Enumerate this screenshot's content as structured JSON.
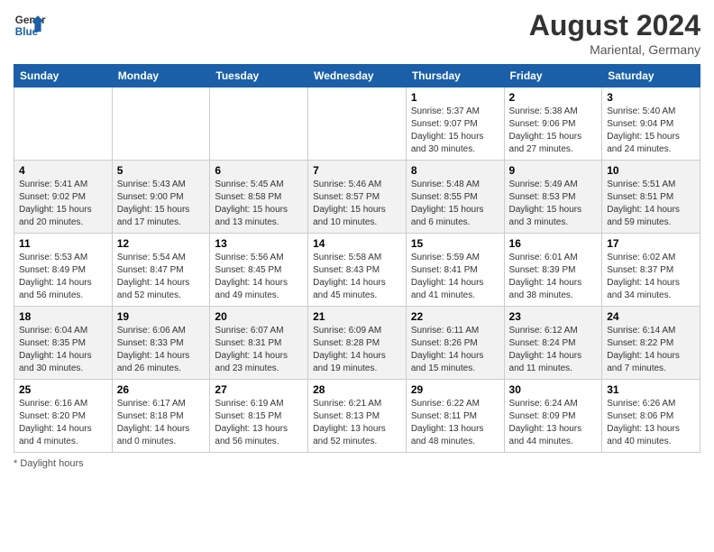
{
  "header": {
    "logo_general": "General",
    "logo_blue": "Blue",
    "month_year": "August 2024",
    "location": "Mariental, Germany"
  },
  "days_of_week": [
    "Sunday",
    "Monday",
    "Tuesday",
    "Wednesday",
    "Thursday",
    "Friday",
    "Saturday"
  ],
  "weeks": [
    [
      {
        "day": "",
        "info": ""
      },
      {
        "day": "",
        "info": ""
      },
      {
        "day": "",
        "info": ""
      },
      {
        "day": "",
        "info": ""
      },
      {
        "day": "1",
        "info": "Sunrise: 5:37 AM\nSunset: 9:07 PM\nDaylight: 15 hours\nand 30 minutes."
      },
      {
        "day": "2",
        "info": "Sunrise: 5:38 AM\nSunset: 9:06 PM\nDaylight: 15 hours\nand 27 minutes."
      },
      {
        "day": "3",
        "info": "Sunrise: 5:40 AM\nSunset: 9:04 PM\nDaylight: 15 hours\nand 24 minutes."
      }
    ],
    [
      {
        "day": "4",
        "info": "Sunrise: 5:41 AM\nSunset: 9:02 PM\nDaylight: 15 hours\nand 20 minutes."
      },
      {
        "day": "5",
        "info": "Sunrise: 5:43 AM\nSunset: 9:00 PM\nDaylight: 15 hours\nand 17 minutes."
      },
      {
        "day": "6",
        "info": "Sunrise: 5:45 AM\nSunset: 8:58 PM\nDaylight: 15 hours\nand 13 minutes."
      },
      {
        "day": "7",
        "info": "Sunrise: 5:46 AM\nSunset: 8:57 PM\nDaylight: 15 hours\nand 10 minutes."
      },
      {
        "day": "8",
        "info": "Sunrise: 5:48 AM\nSunset: 8:55 PM\nDaylight: 15 hours\nand 6 minutes."
      },
      {
        "day": "9",
        "info": "Sunrise: 5:49 AM\nSunset: 8:53 PM\nDaylight: 15 hours\nand 3 minutes."
      },
      {
        "day": "10",
        "info": "Sunrise: 5:51 AM\nSunset: 8:51 PM\nDaylight: 14 hours\nand 59 minutes."
      }
    ],
    [
      {
        "day": "11",
        "info": "Sunrise: 5:53 AM\nSunset: 8:49 PM\nDaylight: 14 hours\nand 56 minutes."
      },
      {
        "day": "12",
        "info": "Sunrise: 5:54 AM\nSunset: 8:47 PM\nDaylight: 14 hours\nand 52 minutes."
      },
      {
        "day": "13",
        "info": "Sunrise: 5:56 AM\nSunset: 8:45 PM\nDaylight: 14 hours\nand 49 minutes."
      },
      {
        "day": "14",
        "info": "Sunrise: 5:58 AM\nSunset: 8:43 PM\nDaylight: 14 hours\nand 45 minutes."
      },
      {
        "day": "15",
        "info": "Sunrise: 5:59 AM\nSunset: 8:41 PM\nDaylight: 14 hours\nand 41 minutes."
      },
      {
        "day": "16",
        "info": "Sunrise: 6:01 AM\nSunset: 8:39 PM\nDaylight: 14 hours\nand 38 minutes."
      },
      {
        "day": "17",
        "info": "Sunrise: 6:02 AM\nSunset: 8:37 PM\nDaylight: 14 hours\nand 34 minutes."
      }
    ],
    [
      {
        "day": "18",
        "info": "Sunrise: 6:04 AM\nSunset: 8:35 PM\nDaylight: 14 hours\nand 30 minutes."
      },
      {
        "day": "19",
        "info": "Sunrise: 6:06 AM\nSunset: 8:33 PM\nDaylight: 14 hours\nand 26 minutes."
      },
      {
        "day": "20",
        "info": "Sunrise: 6:07 AM\nSunset: 8:31 PM\nDaylight: 14 hours\nand 23 minutes."
      },
      {
        "day": "21",
        "info": "Sunrise: 6:09 AM\nSunset: 8:28 PM\nDaylight: 14 hours\nand 19 minutes."
      },
      {
        "day": "22",
        "info": "Sunrise: 6:11 AM\nSunset: 8:26 PM\nDaylight: 14 hours\nand 15 minutes."
      },
      {
        "day": "23",
        "info": "Sunrise: 6:12 AM\nSunset: 8:24 PM\nDaylight: 14 hours\nand 11 minutes."
      },
      {
        "day": "24",
        "info": "Sunrise: 6:14 AM\nSunset: 8:22 PM\nDaylight: 14 hours\nand 7 minutes."
      }
    ],
    [
      {
        "day": "25",
        "info": "Sunrise: 6:16 AM\nSunset: 8:20 PM\nDaylight: 14 hours\nand 4 minutes."
      },
      {
        "day": "26",
        "info": "Sunrise: 6:17 AM\nSunset: 8:18 PM\nDaylight: 14 hours\nand 0 minutes."
      },
      {
        "day": "27",
        "info": "Sunrise: 6:19 AM\nSunset: 8:15 PM\nDaylight: 13 hours\nand 56 minutes."
      },
      {
        "day": "28",
        "info": "Sunrise: 6:21 AM\nSunset: 8:13 PM\nDaylight: 13 hours\nand 52 minutes."
      },
      {
        "day": "29",
        "info": "Sunrise: 6:22 AM\nSunset: 8:11 PM\nDaylight: 13 hours\nand 48 minutes."
      },
      {
        "day": "30",
        "info": "Sunrise: 6:24 AM\nSunset: 8:09 PM\nDaylight: 13 hours\nand 44 minutes."
      },
      {
        "day": "31",
        "info": "Sunrise: 6:26 AM\nSunset: 8:06 PM\nDaylight: 13 hours\nand 40 minutes."
      }
    ]
  ],
  "footer": {
    "note": "Daylight hours"
  }
}
